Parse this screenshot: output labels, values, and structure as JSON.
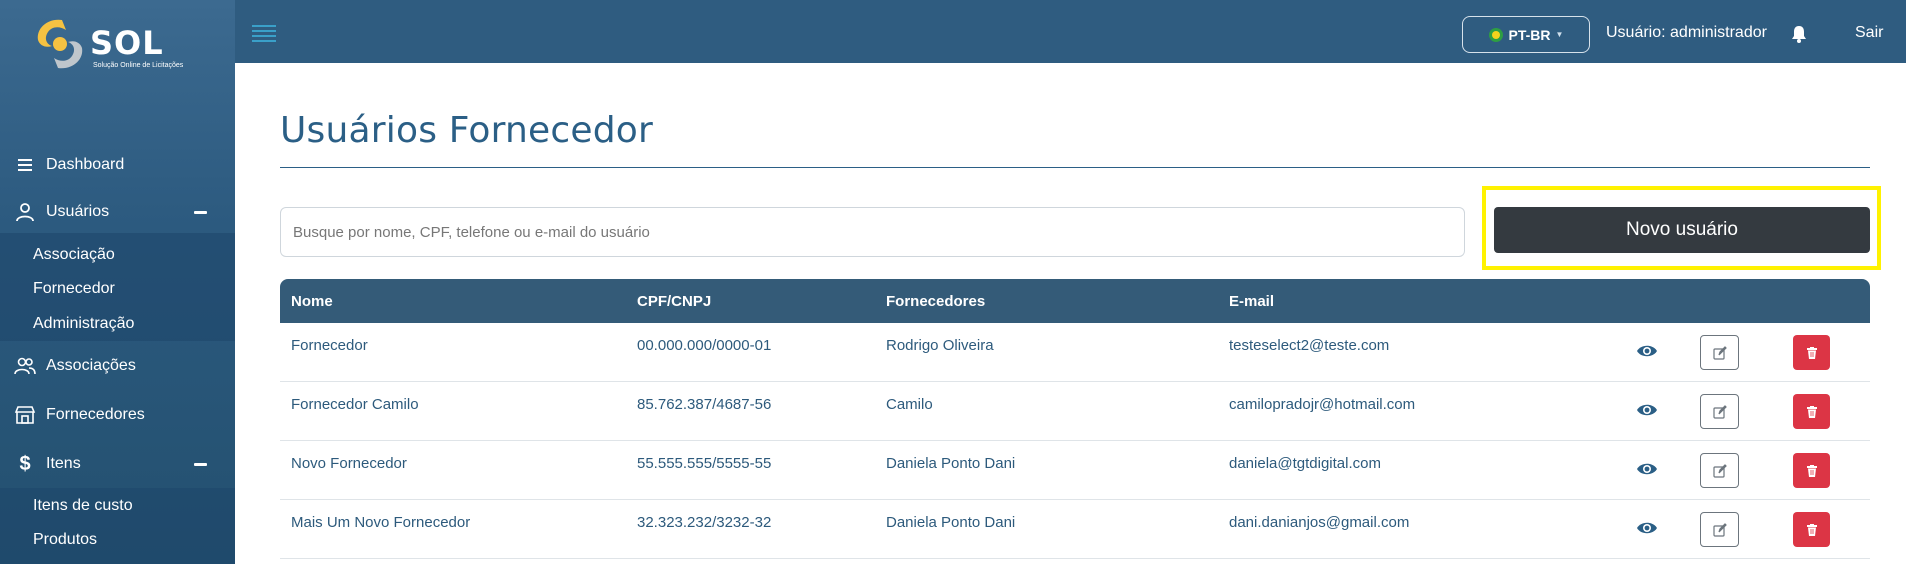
{
  "brand": {
    "name": "SOL",
    "tagline": "Solução Online de Licitações"
  },
  "sidebar": {
    "items": [
      {
        "label": "Dashboard",
        "icon": "menu-icon"
      },
      {
        "label": "Usuários",
        "icon": "user-icon",
        "expanded": true,
        "children": [
          "Associação",
          "Fornecedor",
          "Administração"
        ]
      },
      {
        "label": "Associações",
        "icon": "users-icon"
      },
      {
        "label": "Fornecedores",
        "icon": "store-icon"
      },
      {
        "label": "Itens",
        "icon": "dollar-icon",
        "expanded": true,
        "children": [
          "Itens de custo",
          "Produtos"
        ]
      }
    ]
  },
  "topbar": {
    "language": "PT-BR",
    "user_label": "Usuário: administrador",
    "logout": "Sair"
  },
  "main": {
    "title": "Usuários Fornecedor",
    "search": {
      "placeholder": "Busque por nome, CPF, telefone ou e-mail do usuário",
      "value": ""
    },
    "new_button": "Novo usuário",
    "table": {
      "headers": [
        "Nome",
        "CPF/CNPJ",
        "Fornecedores",
        "E-mail"
      ],
      "rows": [
        {
          "nome": "Fornecedor",
          "cpf": "00.000.000/0000-01",
          "fornecedor": "Rodrigo Oliveira",
          "email": "testeselect2@teste.com"
        },
        {
          "nome": "Fornecedor Camilo",
          "cpf": "85.762.387/4687-56",
          "fornecedor": "Camilo",
          "email": "camilopradojr@hotmail.com"
        },
        {
          "nome": "Novo Fornecedor",
          "cpf": "55.555.555/5555-55",
          "fornecedor": "Daniela Ponto Dani",
          "email": "daniela@tgtdigital.com"
        },
        {
          "nome": "Mais Um Novo Fornecedor",
          "cpf": "32.323.232/3232-32",
          "fornecedor": "Daniela Ponto Dani",
          "email": "dani.danianjos@gmail.com"
        }
      ]
    }
  },
  "colors": {
    "primary": "#2b5f86",
    "sidebar": "#2c5a7f",
    "danger": "#dc3545",
    "dark_button": "#343a40",
    "highlight": "#fff200"
  }
}
